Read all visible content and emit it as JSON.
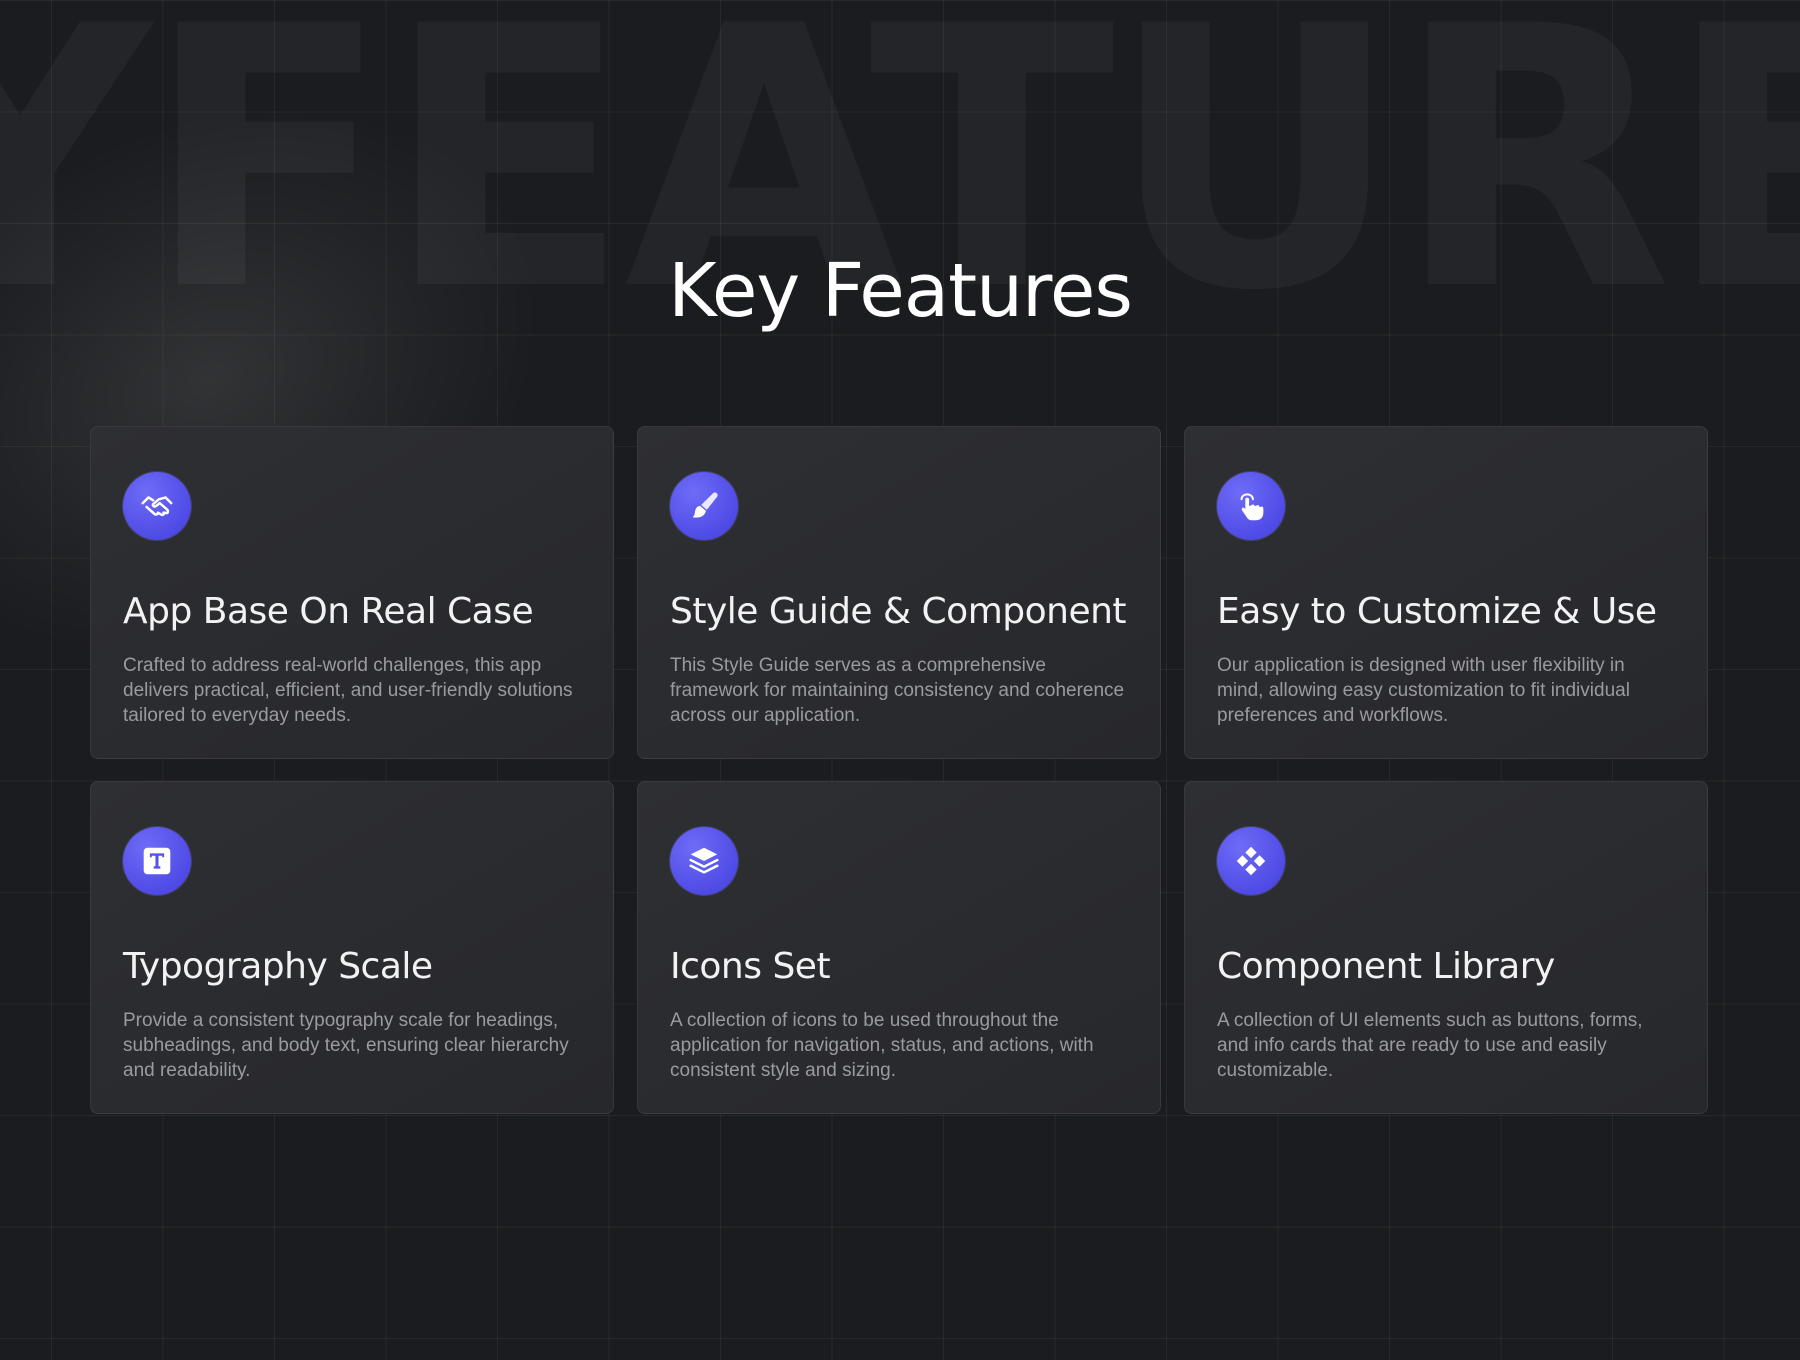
{
  "background": {
    "word": "YFEATURES"
  },
  "header": {
    "title": "Key Features"
  },
  "colors": {
    "background": "#1b1c1f",
    "card": "#2b2c30",
    "accent": "#5552ec",
    "title_text": "#ffffff",
    "body_text": "#9a9aa1"
  },
  "features": [
    {
      "icon": "handshake-icon",
      "title": "App Base On Real Case",
      "description": "Crafted to address real-world challenges, this app delivers practical, efficient, and user-friendly solutions tailored to everyday needs."
    },
    {
      "icon": "paintbrush-icon",
      "title": "Style Guide & Component",
      "description": "This Style Guide serves as a comprehensive framework for maintaining consistency and coherence across our application."
    },
    {
      "icon": "pointer-hand-icon",
      "title": "Easy to Customize & Use",
      "description": "Our application is designed with user flexibility in mind, allowing easy customization to fit individual preferences and workflows."
    },
    {
      "icon": "typography-icon",
      "title": "Typography Scale",
      "description": "Provide a consistent typography scale for headings, subheadings, and body text, ensuring clear hierarchy and readability."
    },
    {
      "icon": "layers-icon",
      "title": "Icons Set",
      "description": "A collection of icons to be used throughout the application for navigation, status, and actions, with consistent style and sizing."
    },
    {
      "icon": "component-icon",
      "title": "Component Library",
      "description": "A collection of UI elements such as buttons, forms, and info cards that are ready to use and easily customizable."
    }
  ]
}
